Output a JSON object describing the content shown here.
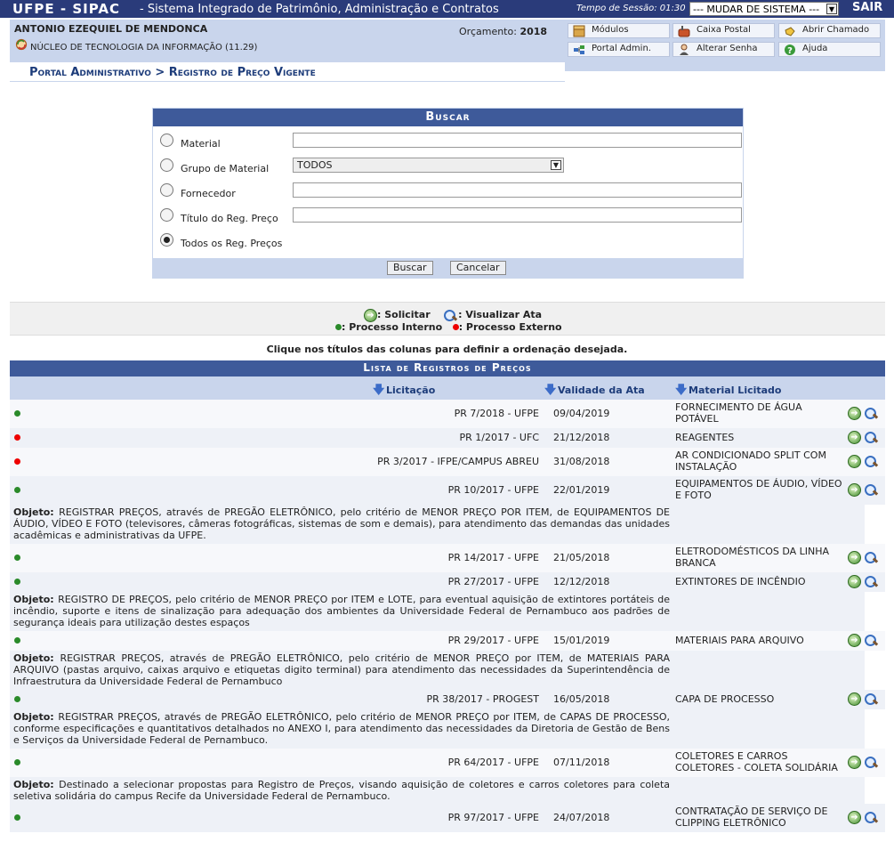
{
  "header": {
    "sys_name": "UFPE - SIPAC",
    "sys_full": "- Sistema Integrado de Patrimônio, Administração e Contratos",
    "session": "Tempo de Sessão: 01:30",
    "mudar": "--- MUDAR DE SISTEMA ---",
    "sair": "SAIR"
  },
  "user": {
    "name": "ANTONIO EZEQUIEL DE MENDONCA",
    "dept": "NÚCLEO DE TECNOLOGIA DA INFORMAÇÃO (11.29)",
    "orc_label": "Orçamento:",
    "orc_value": "2018"
  },
  "menu": {
    "modulos": "Módulos",
    "caixa": "Caixa Postal",
    "chamado": "Abrir Chamado",
    "portal": "Portal Admin.",
    "senha": "Alterar Senha",
    "ajuda": "Ajuda"
  },
  "breadcrumb": "Portal Administrativo > Registro de Preço Vigente",
  "search": {
    "title": "Buscar",
    "material": "Material",
    "grupo": "Grupo de Material",
    "grupo_value": "TODOS",
    "fornecedor": "Fornecedor",
    "titulo": "Título do Reg. Preço",
    "todos": "Todos os Reg. Preços",
    "buscar_btn": "Buscar",
    "cancelar_btn": "Cancelar"
  },
  "legend": {
    "solicitar": ": Solicitar",
    "visualizar": ": Visualizar Ata",
    "interno": ": Processo Interno",
    "externo": ": Processo Externo"
  },
  "hint": "Clique nos títulos das colunas para definir a ordenação desejada.",
  "table": {
    "caption": "Lista de Registros de Preços",
    "col_licitacao": "Licitação",
    "col_validade": "Validade da Ata",
    "col_material": "Material Licitado",
    "obj_label": "Objeto:",
    "rows": [
      {
        "status": "interno",
        "licitacao": "PR 7/2018 - UFPE",
        "validade": "09/04/2019",
        "material": "FORNECIMENTO DE ÁGUA POTÁVEL"
      },
      {
        "status": "externo",
        "licitacao": "PR 1/2017 - UFC",
        "validade": "21/12/2018",
        "material": "REAGENTES"
      },
      {
        "status": "externo",
        "licitacao": "PR 3/2017 - IFPE/CAMPUS ABREU",
        "validade": "31/08/2018",
        "material": "AR CONDICIONADO SPLIT COM INSTALAÇÃO"
      },
      {
        "status": "interno",
        "licitacao": "PR 10/2017 - UFPE",
        "validade": "22/01/2019",
        "material": "EQUIPAMENTOS DE ÁUDIO, VÍDEO E FOTO",
        "objeto": "REGISTRAR PREÇOS, através de PREGÃO ELETRÔNICO, pelo critério de MENOR PREÇO POR ITEM, de EQUIPAMENTOS DE ÁUDIO, VÍDEO E FOTO (televisores, câmeras fotográficas, sistemas de som e demais), para atendimento das demandas das unidades acadêmicas e administrativas da UFPE."
      },
      {
        "status": "interno",
        "licitacao": "PR 14/2017 - UFPE",
        "validade": "21/05/2018",
        "material": "ELETRODOMÉSTICOS DA LINHA BRANCA"
      },
      {
        "status": "interno",
        "licitacao": "PR 27/2017 - UFPE",
        "validade": "12/12/2018",
        "material": "EXTINTORES DE INCÊNDIO",
        "objeto": "REGISTRO DE PREÇOS, pelo critério de MENOR PREÇO por ITEM e LOTE, para eventual aquisição de extintores portáteis de incêndio, suporte e itens de sinalização para adequação dos ambientes da Universidade Federal de Pernambuco aos padrões de segurança ideais para utilização destes espaços"
      },
      {
        "status": "interno",
        "licitacao": "PR 29/2017 - UFPE",
        "validade": "15/01/2019",
        "material": "MATERIAIS PARA ARQUIVO",
        "objeto": "REGISTRAR PREÇOS, através de PREGÃO ELETRÔNICO, pelo critério de MENOR PREÇO por ITEM, de MATERIAIS PARA ARQUIVO (pastas arquivo, caixas arquivo e etiquetas digito terminal) para atendimento das necessidades da Superintendência de Infraestrutura da Universidade Federal de Pernambuco"
      },
      {
        "status": "interno",
        "licitacao": "PR 38/2017 - PROGEST",
        "validade": "16/05/2018",
        "material": "CAPA DE PROCESSO",
        "objeto": "REGISTRAR PREÇOS, através de PREGÃO ELETRÔNICO, pelo critério de MENOR PREÇO por ITEM, de CAPAS DE PROCESSO, conforme especificações e quantitativos detalhados no ANEXO I, para atendimento das necessidades da Diretoria de Gestão de Bens e Serviços da Universidade Federal de Pernambuco."
      },
      {
        "status": "interno",
        "licitacao": "PR 64/2017 - UFPE",
        "validade": "07/11/2018",
        "material": "COLETORES E CARROS COLETORES - COLETA SOLIDÁRIA",
        "objeto": "Destinado a selecionar propostas para Registro de Preços, visando aquisição de coletores e carros coletores para coleta seletiva solidária do campus Recife da Universidade Federal de Pernambuco."
      },
      {
        "status": "interno",
        "licitacao": "PR 97/2017 - UFPE",
        "validade": "24/07/2018",
        "material": "CONTRATAÇÃO DE SERVIÇO DE CLIPPING ELETRÔNICO"
      }
    ]
  },
  "colors": {
    "header_bg": "#2a3b7a",
    "panel_bg": "#c9d5ec",
    "caption_bg": "#3e5a9a",
    "interno": "#2a8a2a",
    "externo": "#ee0000"
  }
}
